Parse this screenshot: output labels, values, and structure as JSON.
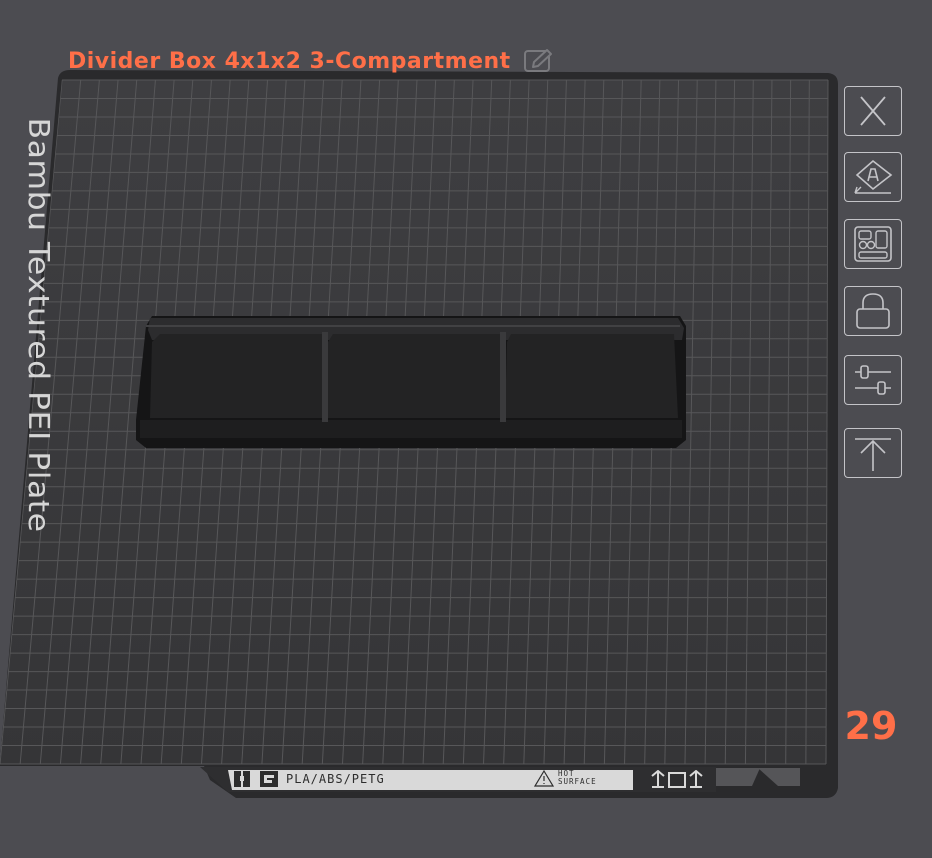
{
  "plate": {
    "title": "Divider Box 4x1x2 3-Compartment",
    "bed_label": "Bambu Textured PEI Plate",
    "plate_number": "29",
    "accent_color": "#ff6f48"
  },
  "strip": {
    "material": "PLA/ABS/PETG",
    "warning_line1": "HOT",
    "warning_line2": "SURFACE"
  },
  "toolbar": {
    "icons": [
      "close-icon",
      "auto-orient-icon",
      "arrange-icon",
      "lock-icon",
      "settings-sliders-icon",
      "move-to-top-icon"
    ]
  }
}
